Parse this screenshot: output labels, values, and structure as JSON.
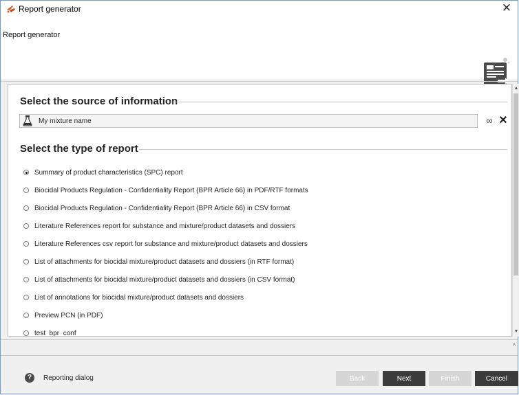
{
  "window": {
    "title": "Report generator",
    "header_label": "Report generator"
  },
  "source_section": {
    "title": "Select the source of information",
    "selected_source": "My mixture name"
  },
  "report_section": {
    "title": "Select the type of report",
    "options": [
      {
        "label": "Summary of product characteristics (SPC) report",
        "checked": true
      },
      {
        "label": "Biocidal Products Regulation - Confidentiality Report (BPR Article 66) in PDF/RTF formats",
        "checked": false
      },
      {
        "label": "Biocidal Products Regulation - Confidentiality Report (BPR Article 66) in CSV format",
        "checked": false
      },
      {
        "label": "Literature References report for substance and mixture/product datasets and dossiers",
        "checked": false
      },
      {
        "label": "Literature References csv report for substance and mixture/product datasets and dossiers",
        "checked": false
      },
      {
        "label": "List of attachments for biocidal mixture/product datasets and dossiers (in RTF format)",
        "checked": false
      },
      {
        "label": "List of attachments for biocidal mixture/product datasets and dossiers (in CSV format)",
        "checked": false
      },
      {
        "label": "List of annotations for biocidal mixture/product datasets and dossiers",
        "checked": false
      },
      {
        "label": "Preview PCN (in PDF)",
        "checked": false
      },
      {
        "label": "test_bpr_conf",
        "checked": false
      }
    ]
  },
  "footer": {
    "help_text": "Reporting dialog",
    "back_label": "Back",
    "next_label": "Next",
    "finish_label": "Finish",
    "cancel_label": "Cancel"
  },
  "colors": {
    "active_button": "#3b3b3b",
    "disabled_button": "#d6d6d6",
    "app_icon_accent": "#e8602c"
  },
  "icons": [
    "app-icon",
    "close-icon",
    "report-icon",
    "flask-icon",
    "link-icon",
    "remove-icon",
    "help-icon"
  ]
}
